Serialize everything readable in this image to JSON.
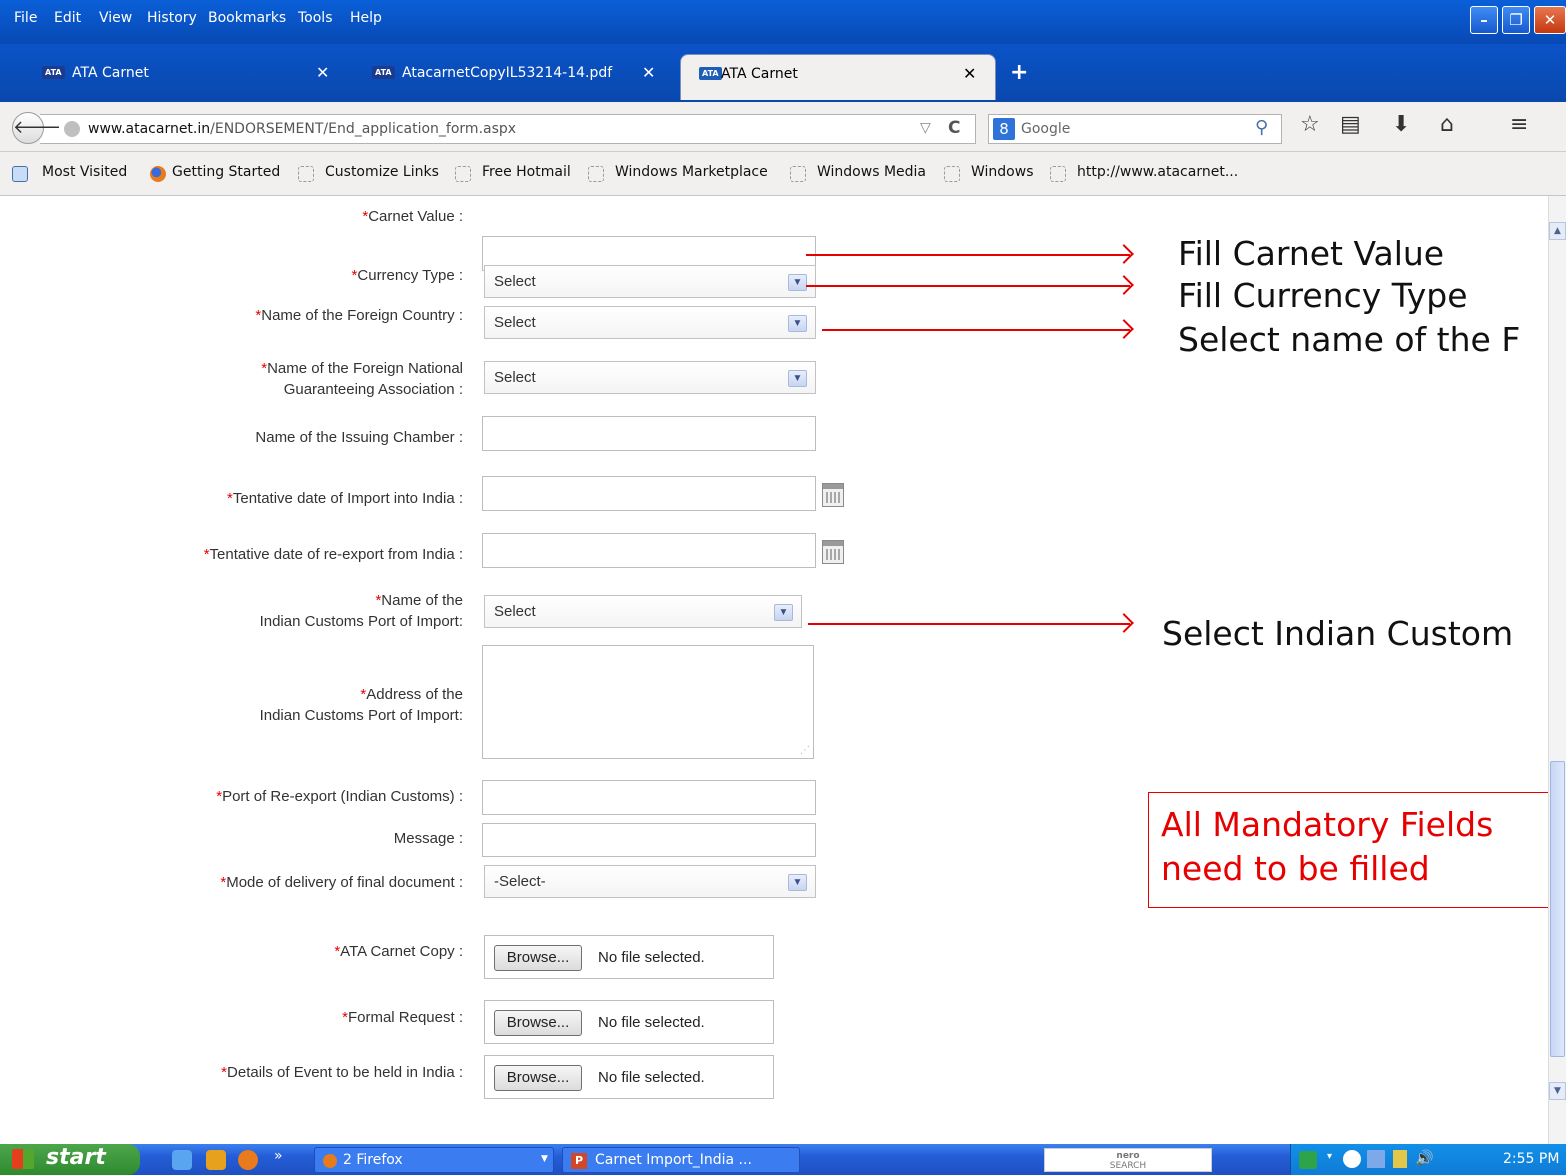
{
  "browser": {
    "menu": [
      "File",
      "Edit",
      "View",
      "History",
      "Bookmarks",
      "Tools",
      "Help"
    ],
    "tabs": [
      {
        "label": "ATA Carnet",
        "favicon": "ATA",
        "active": false
      },
      {
        "label": "AtacarnetCopyIL53214-14.pdf",
        "favicon": "ATA",
        "active": false
      },
      {
        "label": "ATA Carnet",
        "favicon": "ATA",
        "active": true
      }
    ],
    "url_host": "www.atacarnet.in",
    "url_path": "/ENDORSEMENT/End_application_form.aspx",
    "search_engine": "Google",
    "bookmarks": [
      "Most Visited",
      "Getting Started",
      "Customize Links",
      "Free Hotmail",
      "Windows Marketplace",
      "Windows Media",
      "Windows",
      "http://www.atacarnet..."
    ]
  },
  "form": {
    "required_mark": "*",
    "carnet_value": {
      "label": "Carnet Value :",
      "value": ""
    },
    "currency_type": {
      "label": "Currency Type :",
      "selected": "Select"
    },
    "foreign_country": {
      "label": "Name of the Foreign Country :",
      "selected": "Select"
    },
    "foreign_association": {
      "label_line1": "Name of the Foreign National",
      "label_line2": "Guaranteeing Association :",
      "selected": "Select"
    },
    "issuing_chamber": {
      "label": "Name of the Issuing Chamber :",
      "value": ""
    },
    "import_date": {
      "label": "Tentative date of Import into India :",
      "value": ""
    },
    "reexport_date": {
      "label": "Tentative date of re-export from India :",
      "value": ""
    },
    "customs_port": {
      "label_line1": "Name of the",
      "label_line2": "Indian Customs Port of Import:",
      "selected": "Select"
    },
    "customs_address": {
      "label_line1": "Address of the",
      "label_line2": "Indian Customs Port of Import:",
      "value": ""
    },
    "reexport_port": {
      "label": "Port of Re-export (Indian Customs) :",
      "value": ""
    },
    "message": {
      "label": "Message :",
      "value": ""
    },
    "delivery_mode": {
      "label": "Mode of delivery of final document :",
      "selected": "-Select-"
    },
    "uploads": [
      {
        "label": "ATA Carnet Copy :",
        "button": "Browse...",
        "status": "No file selected."
      },
      {
        "label": "Formal Request :",
        "button": "Browse...",
        "status": "No file selected."
      },
      {
        "label": "Details of Event to be held in India :",
        "button": "Browse...",
        "status": "No file selected."
      }
    ]
  },
  "annotations": {
    "carnet_value": "Fill Carnet Value",
    "currency_type": "Fill Currency Type",
    "foreign_country": "Select name of the F",
    "customs_port": "Select Indian Custom",
    "callout_line1": "All Mandatory Fields",
    "callout_line2": "need to be filled",
    "arrow_color": "#e60000"
  },
  "taskbar": {
    "start": "start",
    "tasks": [
      "2 Firefox",
      "Carnet Import_India ..."
    ],
    "search_brand": "nero",
    "search_sub": "SEARCH",
    "clock": "2:55 PM"
  }
}
